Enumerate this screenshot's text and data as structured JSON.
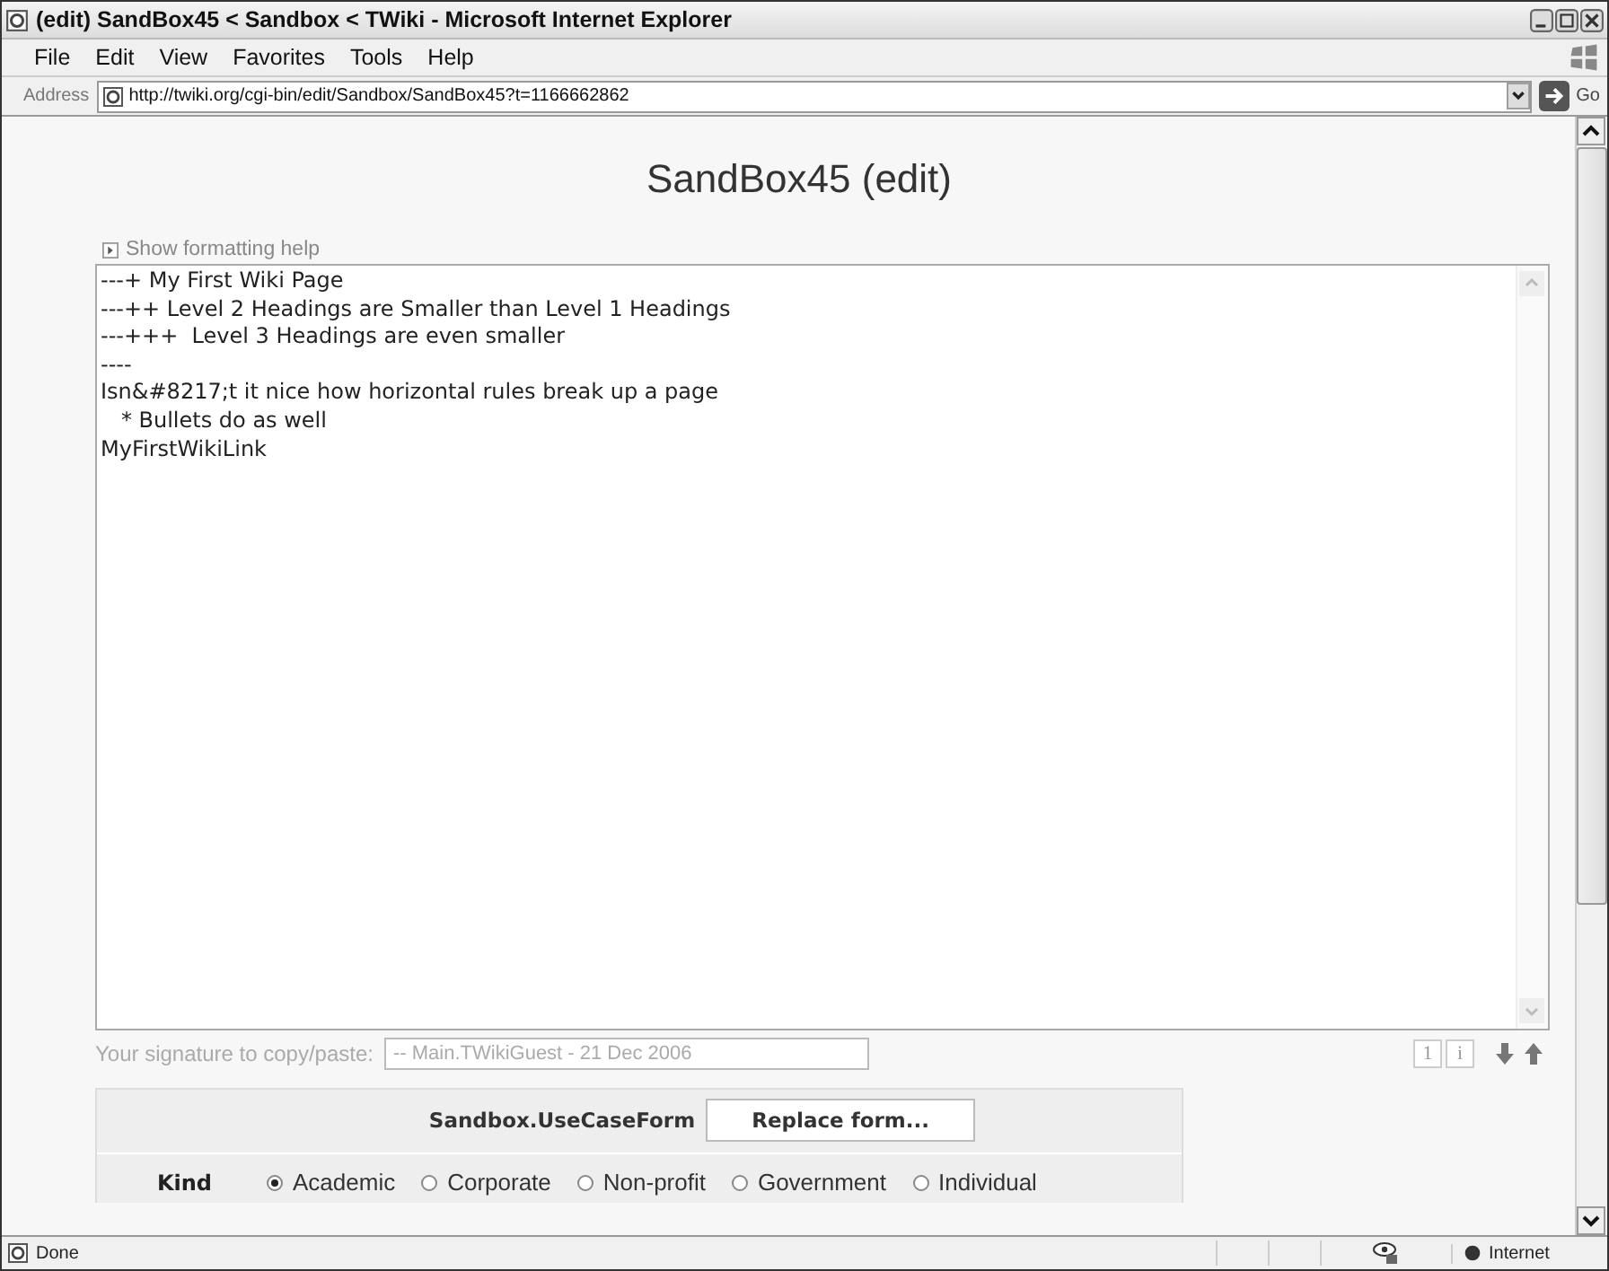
{
  "window": {
    "title": "(edit) SandBox45 < Sandbox < TWiki - Microsoft Internet Explorer"
  },
  "menu": [
    "File",
    "Edit",
    "View",
    "Favorites",
    "Tools",
    "Help"
  ],
  "address_bar": {
    "label": "Address",
    "value": "http://twiki.org/cgi-bin/edit/Sandbox/SandBox45?t=1166662862",
    "go": "Go"
  },
  "page": {
    "heading": "SandBox45 (edit)",
    "help_toggle": {
      "label": "Show formatting help",
      "expanded": false
    },
    "editor": {
      "lines": [
        "---+ My First Wiki Page",
        "---++ Level 2 Headings are Smaller than Level 1 Headings",
        "---+++  Level 3 Headings are even smaller",
        "----",
        "Isn&#8217;t it nice how horizontal rules break up a page",
        "   * Bullets do as well",
        "MyFirstWikiLink"
      ]
    },
    "signature": {
      "label": "Your signature to copy/paste:",
      "value": "-- Main.TWikiGuest - 21 Dec 2006"
    },
    "editor_tools": [
      "1",
      "i"
    ],
    "form": {
      "name": "Sandbox.UseCaseForm",
      "button": "Replace form...",
      "fields": [
        {
          "label": "Kind",
          "options": [
            {
              "label": "Academic",
              "selected": true
            },
            {
              "label": "Corporate",
              "selected": false
            },
            {
              "label": "Non-profit",
              "selected": false
            },
            {
              "label": "Government",
              "selected": false
            },
            {
              "label": "Individual",
              "selected": false
            }
          ]
        }
      ]
    }
  },
  "status_bar": {
    "status": "Done",
    "zone": "Internet"
  }
}
